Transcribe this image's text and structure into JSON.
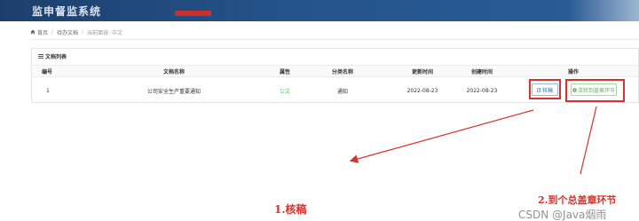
{
  "header": {
    "title": "监申督监系统"
  },
  "breadcrumb": {
    "home": "首页",
    "section": "待办文档",
    "current": "当前面容: 中文"
  },
  "panel": {
    "title": "文档列表"
  },
  "table": {
    "columns": [
      "编号",
      "文档名称",
      "属性",
      "分类名称",
      "更新时间",
      "创建时间",
      "操作"
    ],
    "rows": [
      {
        "id": "1",
        "name": "公司安全生产重要通知",
        "attribute": "公文",
        "category": "通知",
        "updated": "2022-08-23",
        "created": "2022-08-23"
      }
    ],
    "actions": {
      "review": "核稿",
      "to_seal": "流转到盖章环节"
    }
  },
  "annotations": {
    "label_1": "1.核稿",
    "label_2": "2.到个总盖章环节",
    "color": "#d9312b"
  },
  "watermark": "CSDN @Java烟雨",
  "icons": {
    "home": "home-icon",
    "list": "list-icon",
    "edit": "edit-icon",
    "forward": "forward-icon"
  }
}
